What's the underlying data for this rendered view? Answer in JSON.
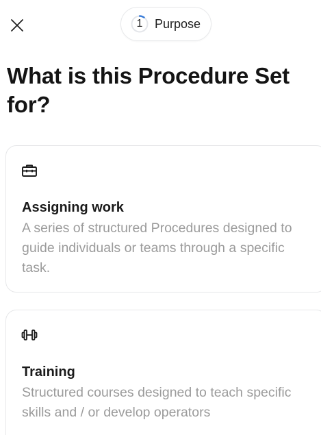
{
  "header": {
    "close_icon": "close-icon",
    "step": {
      "number": "1",
      "label": "Purpose",
      "progress_color": "#3b7dd8"
    }
  },
  "title": "What is this Procedure Set for?",
  "options": [
    {
      "icon": "briefcase-icon",
      "title": "Assigning work",
      "description": "A series of structured Procedures designed to guide individuals or teams through a specific task."
    },
    {
      "icon": "dumbbell-icon",
      "title": "Training",
      "description": "Structured courses designed to teach specific skills and / or develop operators"
    }
  ]
}
